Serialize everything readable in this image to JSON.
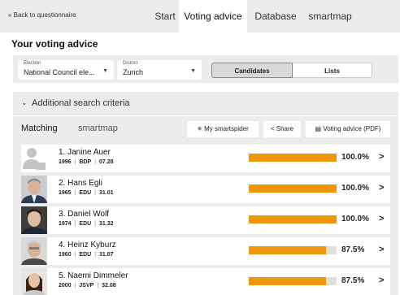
{
  "nav": {
    "back": "« Back to questionnaire",
    "tabs": [
      "Start",
      "Voting advice",
      "Database",
      "smartmap"
    ],
    "active_tab": "Voting advice"
  },
  "page_title": "Your voting advice",
  "filters": {
    "election_label": "Election",
    "election_value": "National Council ele...",
    "district_label": "District",
    "district_value": "Zurich",
    "mode_candidates": "Candidates",
    "mode_lists": "Lists"
  },
  "criteria": {
    "label": "Additional search criteria"
  },
  "results": {
    "tabs": [
      "Matching",
      "smartmap"
    ],
    "buttons": {
      "smartspider": "My smartspider",
      "share": "Share",
      "pdf": "Voting advice (PDF)"
    },
    "candidates": [
      {
        "name": "1. Janine Auer",
        "year": "1996",
        "party": "BDP",
        "list": "07.28",
        "match": "100.0%",
        "match_value": 100.0
      },
      {
        "name": "2. Hans Egli",
        "year": "1965",
        "party": "EDU",
        "list": "31.01",
        "match": "100.0%",
        "match_value": 100.0
      },
      {
        "name": "3. Daniel Wolf",
        "year": "1974",
        "party": "EDU",
        "list": "31.32",
        "match": "100.0%",
        "match_value": 100.0
      },
      {
        "name": "4. Heinz Kyburz",
        "year": "1960",
        "party": "EDU",
        "list": "31.07",
        "match": "87.5%",
        "match_value": 87.5
      },
      {
        "name": "5. Naemi Dimmeler",
        "year": "2000",
        "party": "JSVP",
        "list": "32.08",
        "match": "87.5%",
        "match_value": 87.5
      }
    ]
  },
  "colors": {
    "bar": "#f0960a",
    "bar_track": "#e0e0e0",
    "panel_bg": "#ececec"
  }
}
